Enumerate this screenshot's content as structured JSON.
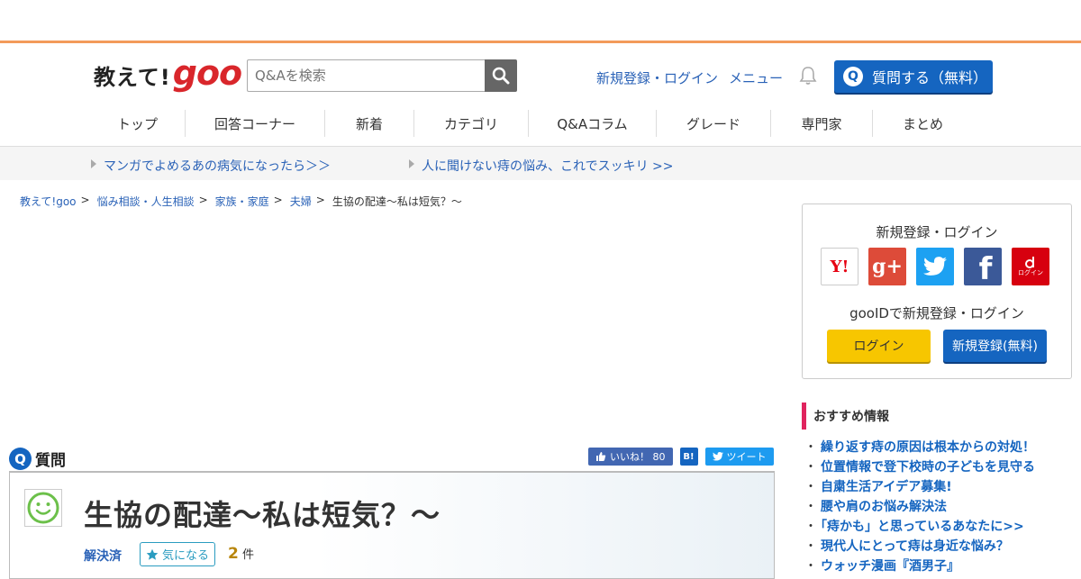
{
  "logo": {
    "main": "教えて!",
    "goo": "goo"
  },
  "search": {
    "placeholder": "Q&Aを検索"
  },
  "header": {
    "register_login": "新規登録・ログイン",
    "menu": "メニュー",
    "ask_label": "質問する（無料）",
    "ask_badge": "Q"
  },
  "nav": {
    "items": [
      {
        "label": "トップ"
      },
      {
        "label": "回答コーナー"
      },
      {
        "label": "新着"
      },
      {
        "label": "カテゴリ"
      },
      {
        "label": "Q&Aコラム"
      },
      {
        "label": "グレード"
      },
      {
        "label": "専門家"
      },
      {
        "label": "まとめ"
      }
    ]
  },
  "promo": {
    "link1": "マンガでよめるあの病気になったら＞＞",
    "link2": "人に聞けない痔の悩み、これでスッキリ >>"
  },
  "breadcrumb": {
    "items": [
      "教えて!goo",
      "悩み相談・人生相談",
      "家族・家庭",
      "夫婦"
    ],
    "current": "生協の配達～私は短気？～",
    "separator": ">"
  },
  "question": {
    "heading_badge": "Q",
    "heading": "質問",
    "title": "生協の配達～私は短気？～",
    "status": "解決済",
    "fav_label": "気になる",
    "count": "2",
    "count_unit": "件",
    "like_label": "いいね！ 80",
    "hatena_label": "B!",
    "tweet_label": "ツイート"
  },
  "login_box": {
    "title": "新規登録・ログイン",
    "sns": [
      {
        "name": "yahoo",
        "label": "Y!",
        "color": "#ffffff"
      },
      {
        "name": "google-plus",
        "label": "g+",
        "color": "#dd4b39"
      },
      {
        "name": "twitter",
        "label": "",
        "color": "#1da1f2"
      },
      {
        "name": "facebook",
        "label": "f",
        "color": "#3b5998"
      },
      {
        "name": "docomo",
        "label": "ログイン",
        "color": "#d7000f"
      }
    ],
    "gooid_text": "gooIDで新規登録・ログイン",
    "login_label": "ログイン",
    "register_label": "新規登録(無料)"
  },
  "recommend": {
    "title": "おすすめ情報",
    "items": [
      "繰り返す痔の原因は根本からの対処！",
      "位置情報で登下校時の子どもを見守る",
      "自粛生活アイデア募集!",
      "腰や肩のお悩み解決法",
      "「痔かも」と思っているあなたに>>",
      "現代人にとって痔は身近な悩み？",
      "ウォッチ漫画『酒男子』"
    ]
  }
}
